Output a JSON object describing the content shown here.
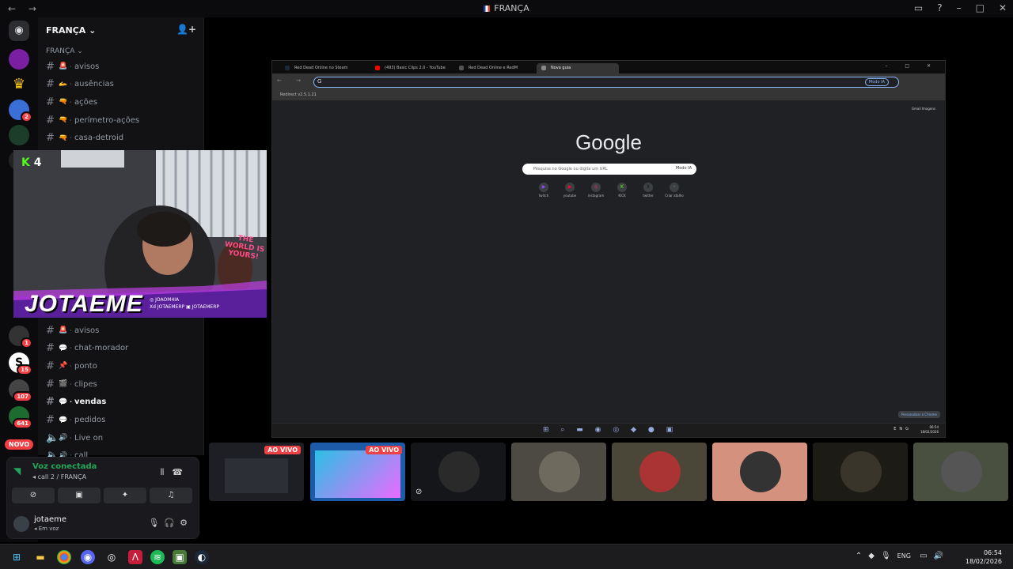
{
  "window": {
    "title": "FRANÇA",
    "nav": "← →"
  },
  "server": {
    "name": "FRANÇA",
    "category": "FRANÇA"
  },
  "channels_top": [
    {
      "emoji": "🚨",
      "label": "avisos"
    },
    {
      "emoji": "🫴",
      "label": "ausências"
    },
    {
      "emoji": "🔫",
      "label": "ações"
    },
    {
      "emoji": "🔫",
      "label": "perímetro-ações"
    },
    {
      "emoji": "🔫",
      "label": "casa-detroid"
    }
  ],
  "channels_bottom": [
    {
      "emoji": "🚨",
      "label": "avisos",
      "type": "text"
    },
    {
      "emoji": "💬",
      "label": "chat-morador",
      "type": "text"
    },
    {
      "emoji": "📌",
      "label": "ponto",
      "type": "text"
    },
    {
      "emoji": "🎬",
      "label": "clipes",
      "type": "text"
    },
    {
      "emoji": "💬",
      "label": "vendas",
      "type": "text",
      "active": true
    },
    {
      "emoji": "💬",
      "label": "pedidos",
      "type": "text"
    },
    {
      "emoji": "🔊",
      "label": "Live on",
      "type": "voice"
    },
    {
      "emoji": "🔊",
      "label": "call",
      "type": "voice"
    }
  ],
  "server_badges": {
    "s2": "2",
    "s8": "1",
    "s9": "15",
    "s10": "107",
    "s11": "641",
    "novo": "NOVO"
  },
  "voice": {
    "status": "Voz conectada",
    "channel": "call 2 / FRANÇA"
  },
  "user": {
    "name": "jotaeme",
    "status": "Em voz"
  },
  "webcam": {
    "k_label": "4",
    "name": "JOTAEME",
    "sign": "THE WORLD IS YOURS!",
    "social1": "JOAOM4IA",
    "social2": "JOTAEMERP",
    "social3": "JOTAEMERP"
  },
  "browser": {
    "tabs": [
      "Red Dead Online no Steam",
      "(493) Basic Clips 2.0 - YouTube",
      "Red Dead Online e RedM",
      "Nova guia"
    ],
    "address": "G",
    "modo": "Modo IA",
    "bookmark": "Redirect v2.5.1.21",
    "logo": "Google",
    "search_placeholder": "Pesquise no Google ou digite um URL",
    "modo_ia": "Modo IA",
    "shortcuts": [
      "twitch",
      "youtube",
      "instagram",
      "KICK",
      "twitter",
      "Criar atalho"
    ],
    "top_links": "Gmail  Imagens",
    "personalize": "Personalizar o Chrome",
    "clock_time": "06:54",
    "clock_date": "18/02/2026",
    "tray": "ENG"
  },
  "tiles": {
    "live": "AO VIVO"
  },
  "taskbar": {
    "lang": "ENG",
    "time": "06:54",
    "date": "18/02/2026"
  }
}
